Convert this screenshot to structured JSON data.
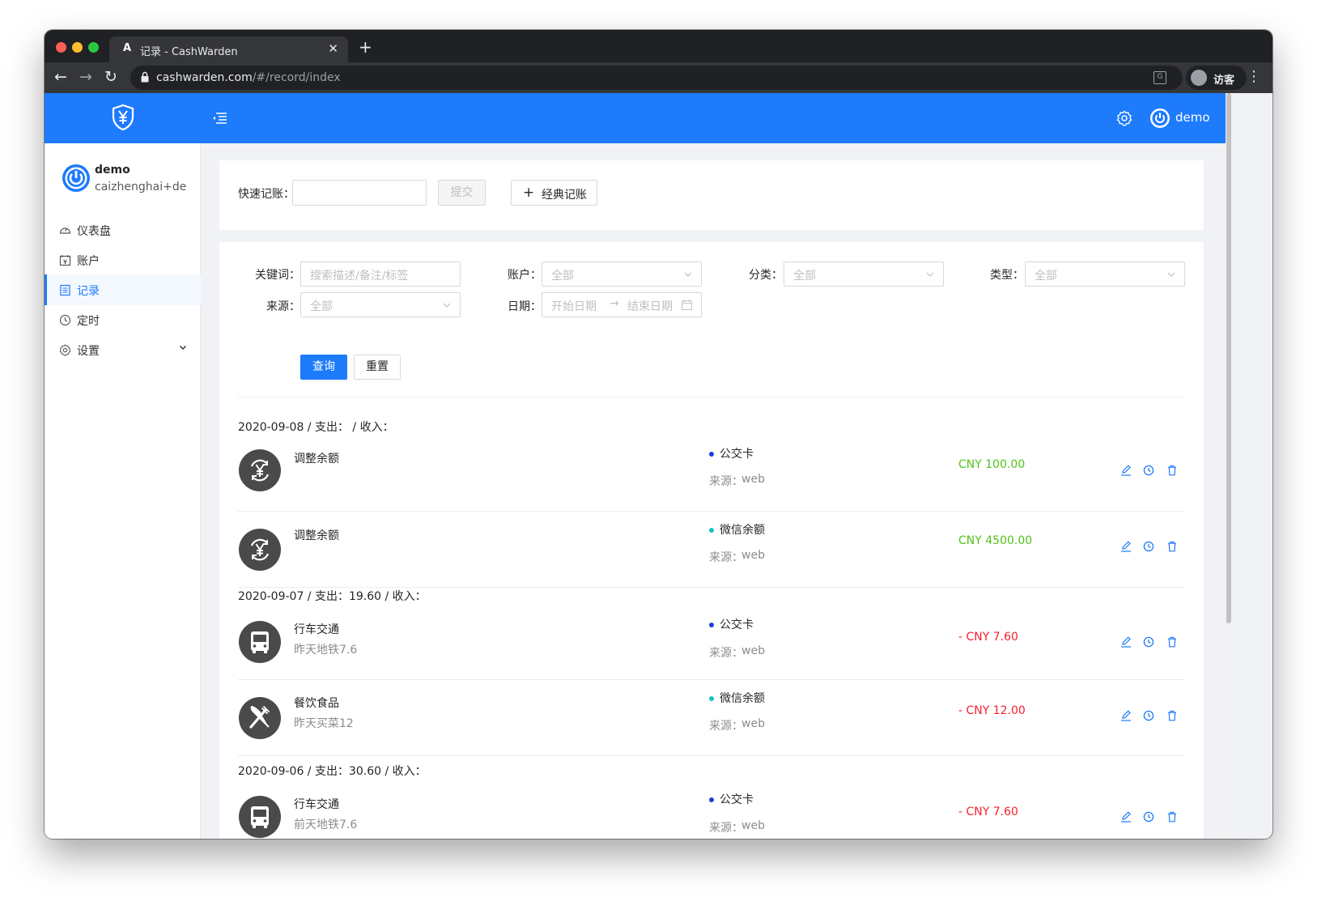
{
  "browser": {
    "tab_title": "记录 - CashWarden",
    "tab_favicon": "A",
    "new_tab_glyph": "+",
    "close_glyph": "✕",
    "url_host": "cashwarden.com",
    "url_path": "/#/record/index",
    "profile_label": "访客",
    "back_glyph": "←",
    "forward_glyph": "→",
    "reload_glyph": "↻",
    "menu_glyph": "⋮",
    "translate_glyph": "G"
  },
  "header": {
    "user_name": "demo",
    "brand_color": "#1d7bfc",
    "icons": [
      "shield-yen-logo-icon",
      "menu-fold-icon",
      "gear-icon",
      "power-avatar-icon"
    ]
  },
  "sidebar": {
    "user_name": "demo",
    "user_email": "caizhenghai+dem",
    "items": [
      {
        "label": "仪表盘",
        "icon": "dashboard-icon"
      },
      {
        "label": "账户",
        "icon": "account-book-icon"
      },
      {
        "label": "记录",
        "icon": "list-icon",
        "active": true
      },
      {
        "label": "定时",
        "icon": "clock-icon"
      },
      {
        "label": "设置",
        "icon": "gear-icon",
        "expandable": true
      }
    ]
  },
  "quick": {
    "label": "快速记账：",
    "input_value": "",
    "submit_label": "提交",
    "classic_label": "经典记账",
    "classic_glyph": "+"
  },
  "filters": {
    "keyword_label": "关键词：",
    "keyword_placeholder": "搜索描述/备注/标签",
    "account_label": "账户：",
    "account_value": "全部",
    "category_label": "分类：",
    "category_value": "全部",
    "type_label": "类型：",
    "type_value": "全部",
    "source_label": "来源：",
    "source_value": "全部",
    "date_label": "日期：",
    "date_start_placeholder": "开始日期",
    "date_arrow": "→",
    "date_end_placeholder": "结束日期",
    "query_label": "查询",
    "reset_label": "重置"
  },
  "groups": [
    {
      "header": "2020-09-08 / 支出： / 收入：",
      "records": [
        {
          "category": "调整余额",
          "icon": "yen-adjust-icon",
          "description": "",
          "account": "公交卡",
          "account_color": "#1b3fd8",
          "source_label": "来源：",
          "source": "web",
          "amount": "CNY 100.00",
          "direction": "pos"
        },
        {
          "category": "调整余额",
          "icon": "yen-adjust-icon",
          "description": "",
          "account": "微信余额",
          "account_color": "#13c2c2",
          "source_label": "来源：",
          "source": "web",
          "amount": "CNY 4500.00",
          "direction": "pos"
        }
      ]
    },
    {
      "header": "2020-09-07 / 支出：19.60 / 收入：",
      "records": [
        {
          "category": "行车交通",
          "icon": "bus-icon",
          "description": "昨天地铁7.6",
          "account": "公交卡",
          "account_color": "#1b3fd8",
          "source_label": "来源：",
          "source": "web",
          "amount": "- CNY 7.60",
          "direction": "neg"
        },
        {
          "category": "餐饮食品",
          "icon": "fork-knife-icon",
          "description": "昨天买菜12",
          "account": "微信余额",
          "account_color": "#13c2c2",
          "source_label": "来源：",
          "source": "web",
          "amount": "- CNY 12.00",
          "direction": "neg"
        }
      ]
    },
    {
      "header": "2020-09-06 / 支出：30.60 / 收入：",
      "records": [
        {
          "category": "行车交通",
          "icon": "bus-icon",
          "description": "前天地铁7.6",
          "account": "公交卡",
          "account_color": "#1b3fd8",
          "source_label": "来源：",
          "source": "web",
          "amount": "- CNY 7.60",
          "direction": "neg"
        }
      ]
    }
  ],
  "row_actions": [
    "edit-icon",
    "schedule-icon",
    "delete-icon"
  ],
  "colors": {
    "income": "#52c41a",
    "expense": "#f5222d",
    "link": "#1d7bfc"
  }
}
